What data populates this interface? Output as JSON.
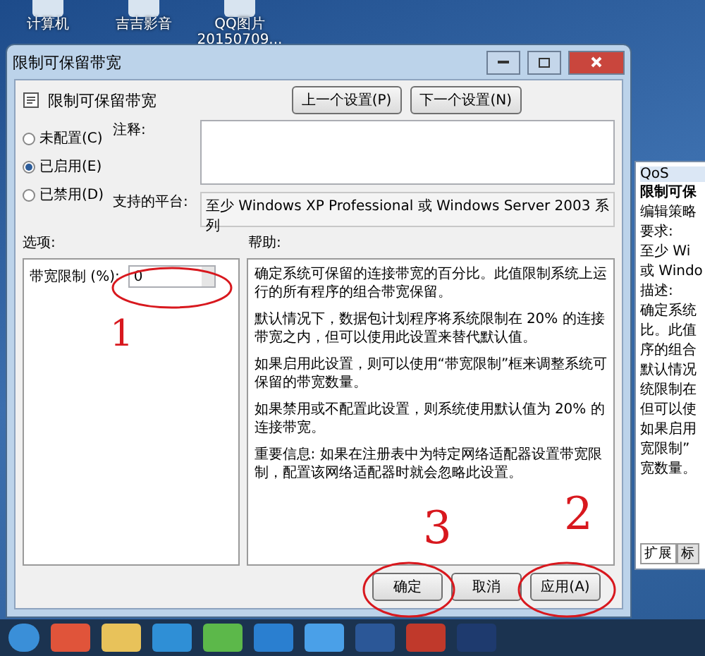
{
  "desktop_icons": [
    {
      "label": "计算机"
    },
    {
      "label": "吉吉影音"
    },
    {
      "label": "QQ图片\n20150709..."
    }
  ],
  "dialog": {
    "title": "限制可保留带宽",
    "heading": "限制可保留带宽",
    "prev_button": "上一个设置(P)",
    "next_button": "下一个设置(N)",
    "radios": [
      {
        "label": "未配置(C)",
        "selected": false
      },
      {
        "label": "已启用(E)",
        "selected": true
      },
      {
        "label": "已禁用(D)",
        "selected": false
      }
    ],
    "comment_label": "注释:",
    "platform_label": "支持的平台:",
    "platform_value": "至少 Windows XP Professional 或 Windows Server 2003 系列",
    "options_label": "选项:",
    "help_label": "帮助:",
    "option": {
      "label": "带宽限制 (%):",
      "value": "0"
    },
    "help_paragraphs": [
      "确定系统可保留的连接带宽的百分比。此值限制系统上运行的所有程序的组合带宽保留。",
      "默认情况下，数据包计划程序将系统限制在 20% 的连接带宽之内，但可以使用此设置来替代默认值。",
      "如果启用此设置，则可以使用“带宽限制”框来调整系统可保留的带宽数量。",
      "如果禁用或不配置此设置，则系统使用默认值为 20% 的连接带宽。",
      "重要信息: 如果在注册表中为特定网络适配器设置带宽限制，配置该网络适配器时就会忽略此设置。"
    ],
    "buttons": [
      {
        "label": "确定"
      },
      {
        "label": "取消"
      },
      {
        "label": "应用(A)"
      }
    ]
  },
  "background_window": {
    "title": "QoS",
    "lines": [
      "限制可保",
      "编辑策略",
      "要求:",
      "至少 Wi",
      "或 Windo",
      "描述:",
      "确定系统",
      "比。此值",
      "序的组合",
      "默认情况",
      "统限制在",
      "但可以使",
      "如果启用",
      "宽限制”",
      "宽数量。"
    ],
    "tabs": [
      {
        "label": "扩展",
        "selected": true
      },
      {
        "label": "标",
        "selected": false
      }
    ]
  },
  "annotations": [
    {
      "label": "1"
    },
    {
      "label": "3"
    },
    {
      "label": "2"
    }
  ]
}
